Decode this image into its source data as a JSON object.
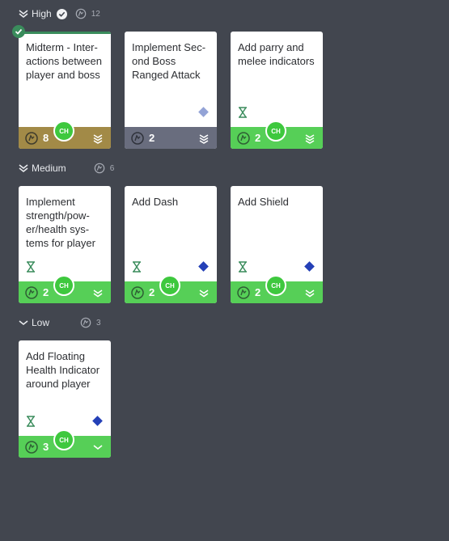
{
  "groups": [
    {
      "label": "High",
      "points": "12",
      "complete": true
    },
    {
      "label": "Medium",
      "points": "6",
      "complete": false
    },
    {
      "label": "Low",
      "points": "3",
      "complete": false
    }
  ],
  "colors": {
    "done_footer": "#a28a47",
    "gray_footer": "#696d7e",
    "green_footer": "#56cf57",
    "diamond_blue": "#2440b7",
    "diamond_light": "#93a3d6",
    "hourglass": "#3a8c5c"
  },
  "cards": [
    {
      "title": "Midterm - Inter­actions be­tween player and boss",
      "points": "8",
      "avatar": "CH",
      "status": "done",
      "priority": "high"
    },
    {
      "title": "Implement Sec­ond Boss Ranged Attack",
      "points": "2",
      "avatar": "",
      "status": "todo-gray",
      "priority": "high"
    },
    {
      "title": "Add parry and melee indicators",
      "points": "2",
      "avatar": "CH",
      "status": "in-progress",
      "priority": "high"
    },
    {
      "title": "Implement strength/pow­er/health sys­tems for player",
      "points": "2",
      "avatar": "CH",
      "status": "in-progress",
      "priority": "medium"
    },
    {
      "title": "Add Dash",
      "points": "2",
      "avatar": "CH",
      "status": "in-progress",
      "priority": "medium"
    },
    {
      "title": "Add Shield",
      "points": "2",
      "avatar": "CH",
      "status": "in-progress",
      "priority": "medium"
    },
    {
      "title": "Add Floating Health Indica­tor around player",
      "points": "3",
      "avatar": "CH",
      "status": "in-progress",
      "priority": "low"
    }
  ],
  "icons": {
    "group_chevron": "double-chevron-icon",
    "points": "points-icon",
    "check": "check-icon",
    "hourglass": "hourglass-icon",
    "diamond": "diamond-icon"
  }
}
